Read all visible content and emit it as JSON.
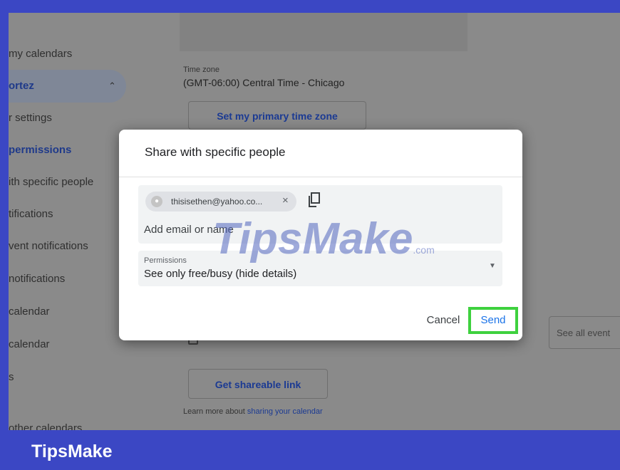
{
  "sidebar": {
    "items": [
      {
        "label": "my calendars"
      },
      {
        "label": "ortez"
      },
      {
        "label": "r settings"
      },
      {
        "label": "permissions"
      },
      {
        "label": "ith specific people"
      },
      {
        "label": "tifications"
      },
      {
        "label": "vent notifications"
      },
      {
        "label": "notifications"
      },
      {
        "label": "calendar"
      },
      {
        "label": "calendar"
      },
      {
        "label": "s"
      }
    ],
    "bottom_label": "other calendars"
  },
  "main": {
    "timezone_label": "Time zone",
    "timezone_value": "(GMT-06:00) Central Time - Chicago",
    "primary_tz_button": "Set my primary time zone",
    "see_all_button": "See all event",
    "shareable_link_button": "Get shareable link",
    "learn_more_prefix": "Learn more about ",
    "learn_more_link": "sharing your calendar"
  },
  "dialog": {
    "title": "Share with specific people",
    "chip_email": "thisisethen@yahoo.co...",
    "chip_remove": "×",
    "email_placeholder": "Add email or name",
    "permissions_label": "Permissions",
    "permissions_value": "See only free/busy (hide details)",
    "cancel_label": "Cancel",
    "send_label": "Send"
  },
  "watermark": {
    "main": "TipsMake",
    "suffix": ".com"
  },
  "brand": "TipsMake",
  "icons": {
    "avatar": "person-icon",
    "copy": "copy-icon",
    "dropdown": "dropdown-arrow-icon",
    "chevron": "chevron-up-icon"
  },
  "colors": {
    "frame": "#3b47c4",
    "overlay": "#8a8a8a",
    "accent": "#1a73e8",
    "highlight": "#3ed13e"
  }
}
